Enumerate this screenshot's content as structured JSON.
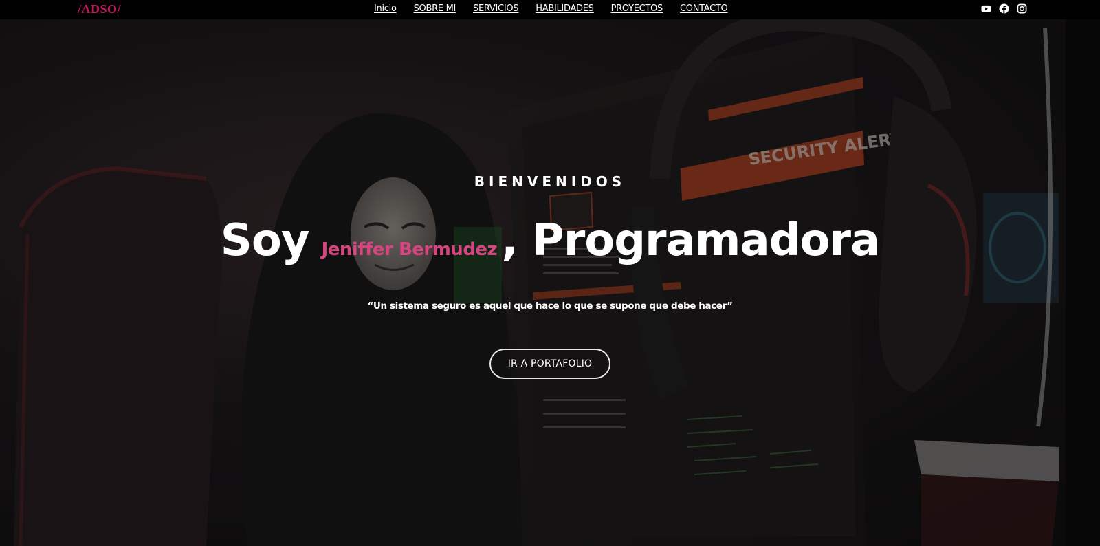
{
  "navbar": {
    "brand": "/ADSO/",
    "links": [
      {
        "label": "Inicio"
      },
      {
        "label": "SOBRE MI"
      },
      {
        "label": "SERVICIOS"
      },
      {
        "label": "HABILIDADES"
      },
      {
        "label": "PROYECTOS"
      },
      {
        "label": "CONTACTO"
      }
    ],
    "socials": [
      {
        "icon": "youtube-icon"
      },
      {
        "icon": "facebook-icon"
      },
      {
        "icon": "instagram-icon"
      }
    ]
  },
  "hero": {
    "welcome": "BIENVENIDOS",
    "headline_prefix": "Soy",
    "name": "Jeniffer Bermudez",
    "headline_suffix": ", Programadora",
    "quote": "“Un sistema seguro es aquel que hace lo que se supone que debe hacer”",
    "cta_label": "IR A PORTAFOLIO",
    "background_text": "SECURITY ALERT"
  },
  "colors": {
    "brand": "#c2185b",
    "accent_name": "#d6457f",
    "navbar_bg": "#000000",
    "text": "#ffffff"
  }
}
